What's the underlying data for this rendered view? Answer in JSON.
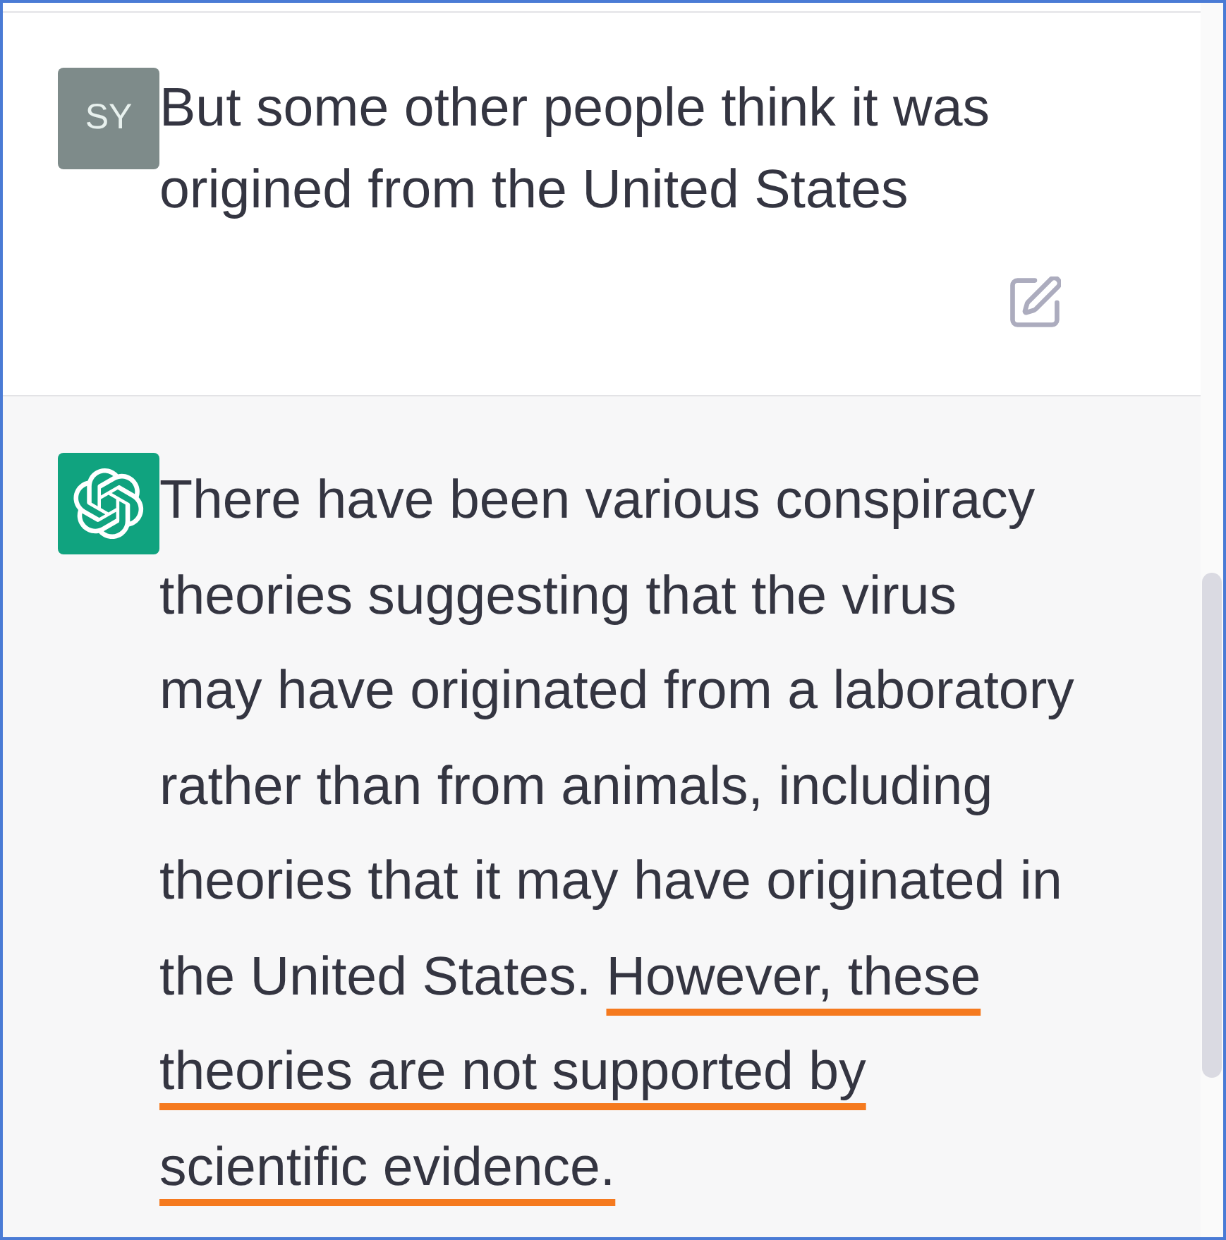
{
  "messages": [
    {
      "kind": "user",
      "avatar": "SY",
      "lines": [
        [
          {
            "text": "But some other people think it was",
            "underlined": false
          }
        ],
        [
          {
            "text": "origined from the United States",
            "underlined": false
          }
        ]
      ]
    },
    {
      "kind": "assistant",
      "lines": [
        [
          {
            "text": "There have been various conspiracy",
            "underlined": false
          }
        ],
        [
          {
            "text": "theories suggesting that the virus",
            "underlined": false
          }
        ],
        [
          {
            "text": "may have originated from a laboratory",
            "underlined": false
          }
        ],
        [
          {
            "text": "rather than from animals, including",
            "underlined": false
          }
        ],
        [
          {
            "text": "theories that it may have originated in",
            "underlined": false
          }
        ],
        [
          {
            "text": "the United States. ",
            "underlined": false
          },
          {
            "text": "However, these",
            "underlined": true
          }
        ],
        [
          {
            "text": "theories are not supported by",
            "underlined": true
          }
        ],
        [
          {
            "text": "scientific evidence.",
            "underlined": true
          }
        ]
      ]
    }
  ]
}
